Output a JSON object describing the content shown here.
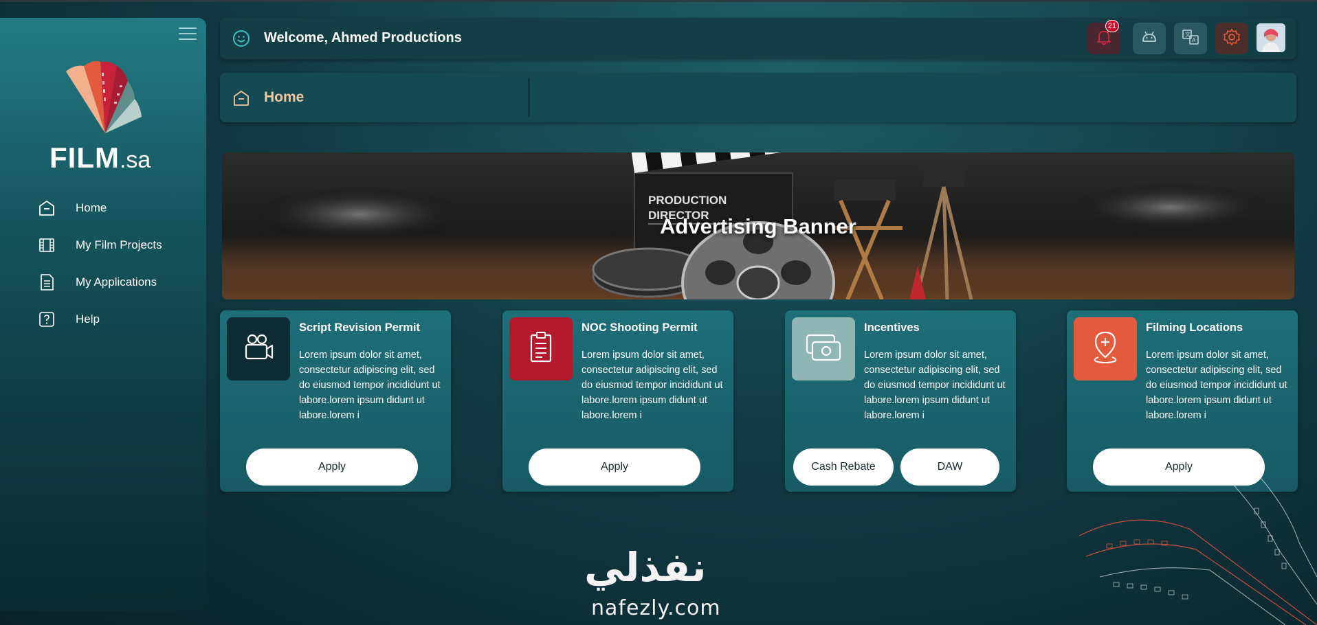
{
  "app": {
    "logo_text_main": "FILM",
    "logo_text_suffix": ".sa"
  },
  "sidebar": {
    "items": [
      {
        "label": "Home",
        "icon": "home-icon"
      },
      {
        "label": "My Film Projects",
        "icon": "film-icon"
      },
      {
        "label": "My Applications",
        "icon": "document-icon"
      },
      {
        "label": "Help",
        "icon": "help-icon"
      }
    ]
  },
  "header": {
    "welcome": "Welcome, Ahmed Productions",
    "notifications_count": "21",
    "icons": [
      "bell-icon",
      "android-icon",
      "translate-icon",
      "settings-icon"
    ]
  },
  "breadcrumb": {
    "title": "Home"
  },
  "banner": {
    "title": "Advertising Banner",
    "clapper_text": [
      "PRODUCTION",
      "DIRECTOR"
    ]
  },
  "cards": [
    {
      "title": "Script Revision Permit",
      "description": "Lorem ipsum dolor sit amet, consectetur adipiscing elit, sed do eiusmod tempor incididunt ut labore.lorem ipsum didunt ut labore.lorem i",
      "buttons": [
        "Apply"
      ],
      "icon": "camera-icon",
      "color": "#0f2c36"
    },
    {
      "title": "NOC Shooting Permit",
      "description": "Lorem ipsum dolor sit amet, consectetur adipiscing elit, sed do eiusmod tempor incididunt ut labore.lorem ipsum didunt ut labore.lorem i",
      "buttons": [
        "Apply"
      ],
      "icon": "clipboard-icon",
      "color": "#b5192e"
    },
    {
      "title": "Incentives",
      "description": "Lorem ipsum dolor sit amet, consectetur adipiscing elit, sed do eiusmod tempor incididunt ut labore.lorem ipsum didunt ut labore.lorem i",
      "buttons": [
        "Cash Rebate",
        "DAW"
      ],
      "icon": "money-icon",
      "color": "#8fb6b3"
    },
    {
      "title": "Filming Locations",
      "description": "Lorem ipsum dolor sit amet, consectetur adipiscing elit, sed do eiusmod tempor incididunt ut labore.lorem ipsum didunt ut labore.lorem i",
      "buttons": [
        "Apply"
      ],
      "icon": "location-pin-icon",
      "color": "#e35a3c"
    }
  ],
  "footer": {
    "arabic_logo": "نفذلي",
    "latin_logo": "nafezly.com"
  }
}
